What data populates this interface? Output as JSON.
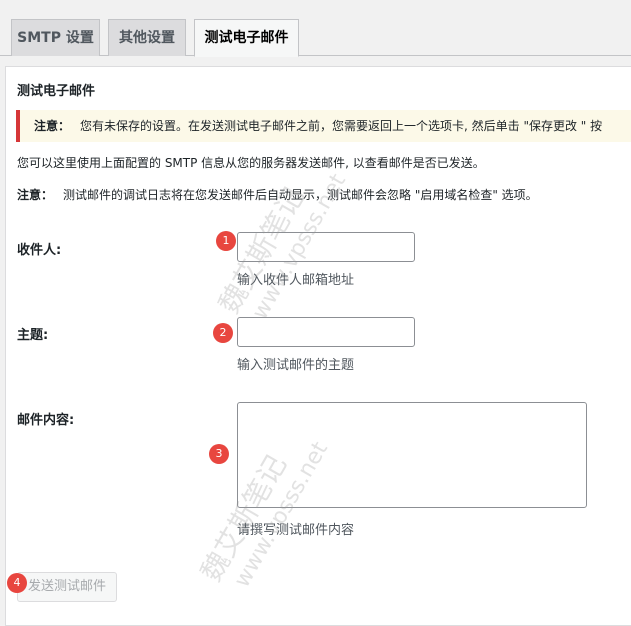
{
  "tabs": [
    {
      "label": "SMTP 设置"
    },
    {
      "label": "其他设置"
    },
    {
      "label": "测试电子邮件"
    }
  ],
  "section_title": "测试电子邮件",
  "notice": {
    "prefix": "注意：",
    "text": "您有未保存的设置。在发送测试电子邮件之前，您需要返回上一个选项卡, 然后单击 \"保存更改 \" 按"
  },
  "intro": "您可以这里使用上面配置的 SMTP 信息从您的服务器发送邮件, 以查看邮件是否已发送。",
  "note": {
    "prefix": "注意：",
    "text": "测试邮件的调试日志将在您发送邮件后自动显示，测试邮件会忽略 \"启用域名检查\" 选项。"
  },
  "fields": {
    "recipient": {
      "label": "收件人:",
      "value": "",
      "description": "输入收件人邮箱地址"
    },
    "subject": {
      "label": "主题:",
      "value": "",
      "description": "输入测试邮件的主题"
    },
    "body": {
      "label": "邮件内容:",
      "value": "",
      "description": "请撰写测试邮件内容"
    }
  },
  "send_button": {
    "label": "发送测试邮件"
  },
  "markers": [
    "1",
    "2",
    "3",
    "4"
  ],
  "watermark": {
    "line1": "魏艾斯笔记",
    "line2": "www.vpsss.net"
  },
  "colors": {
    "marker": "#e8463f",
    "notice_border": "#d63638",
    "notice_bg": "#fcf9e8"
  }
}
